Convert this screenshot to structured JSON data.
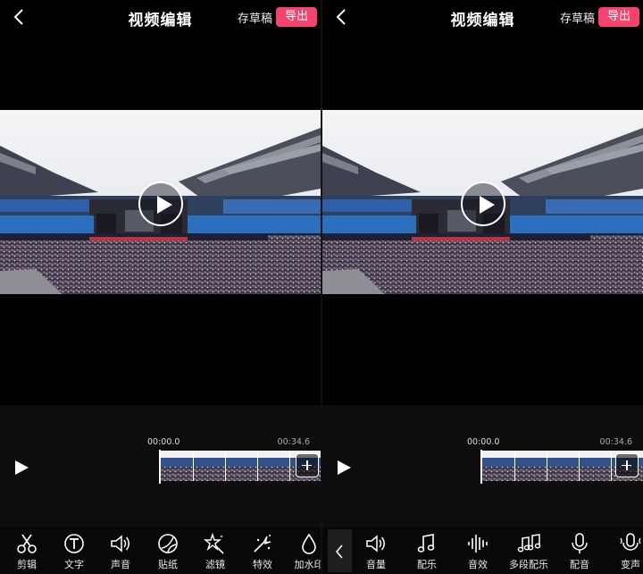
{
  "left": {
    "header": {
      "title": "视频编辑",
      "draft_label": "存草稿",
      "export_label": "导出"
    },
    "timeline": {
      "start_time": "00:00.0",
      "end_time": "00:34.6"
    },
    "tools": [
      {
        "icon": "scissors-icon",
        "label": "剪辑"
      },
      {
        "icon": "text-icon",
        "label": "文字"
      },
      {
        "icon": "speaker-icon",
        "label": "声音"
      },
      {
        "icon": "sticker-icon",
        "label": "贴纸"
      },
      {
        "icon": "filter-icon",
        "label": "滤镜"
      },
      {
        "icon": "effect-icon",
        "label": "特效"
      },
      {
        "icon": "watermark-icon",
        "label": "加水印"
      }
    ]
  },
  "right": {
    "header": {
      "title": "视频编辑",
      "draft_label": "存草稿",
      "export_label": "导出"
    },
    "timeline": {
      "start_time": "00:00.0",
      "end_time": "00:34.6"
    },
    "tools": [
      {
        "icon": "volume-icon",
        "label": "音量"
      },
      {
        "icon": "music-note-icon",
        "label": "配乐"
      },
      {
        "icon": "sound-wave-icon",
        "label": "音效"
      },
      {
        "icon": "multi-music-icon",
        "label": "多段配乐"
      },
      {
        "icon": "microphone-icon",
        "label": "配音"
      },
      {
        "icon": "voice-change-icon",
        "label": "变声"
      }
    ]
  },
  "colors": {
    "accent": "#f4436c",
    "background": "#000000",
    "editor_bg": "#0d0d0d"
  }
}
